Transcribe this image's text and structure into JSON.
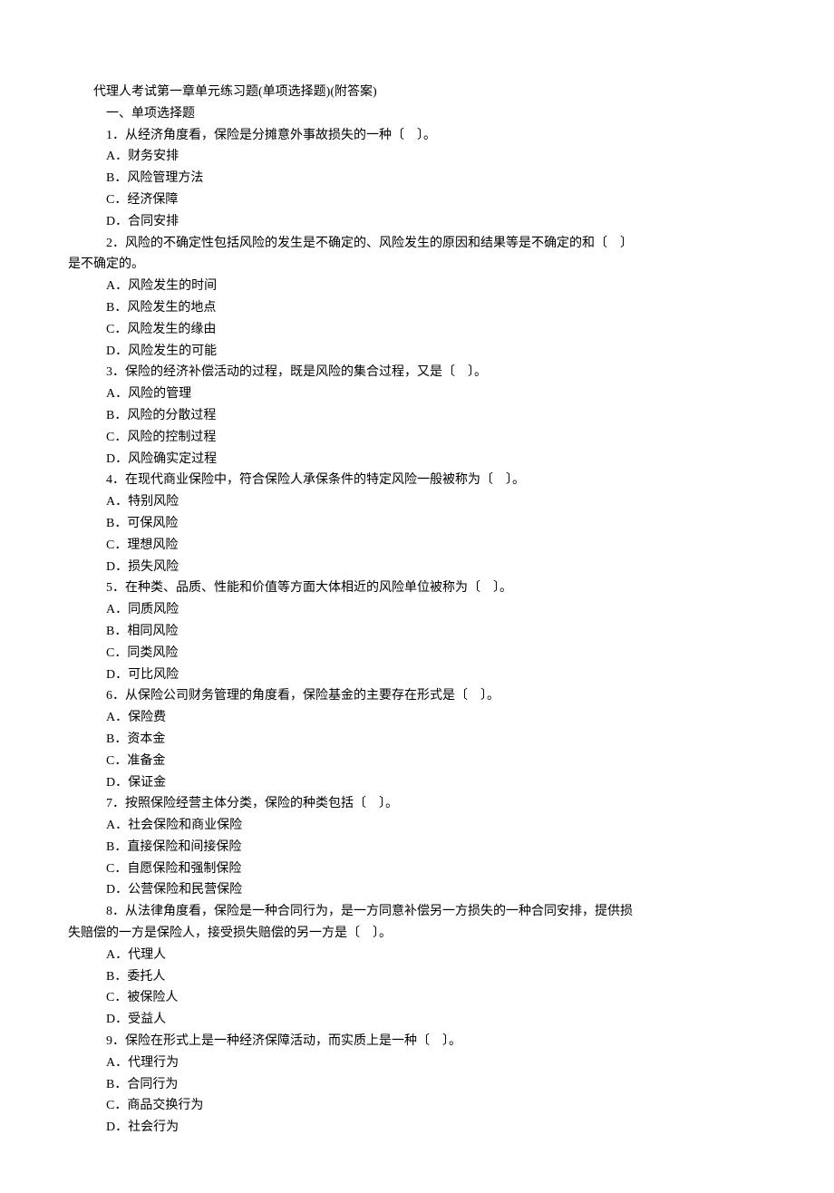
{
  "title": "代理人考试第一章单元练习题(单项选择题)(附答案)",
  "section_header": "一、单项选择题",
  "questions": [
    {
      "stem": "1．从经济角度看，保险是分摊意外事故损失的一种〔　〕。",
      "options": [
        "A．财务安排",
        "B．风险管理方法",
        "C．经济保障",
        "D．合同安排"
      ]
    },
    {
      "stem": "2．风险的不确定性包括风险的发生是不确定的、风险发生的原因和结果等是不确定的和〔　〕",
      "stem_cont": "是不确定的。",
      "options": [
        "A．风险发生的时间",
        "B．风险发生的地点",
        "C．风险发生的缘由",
        "D．风险发生的可能"
      ]
    },
    {
      "stem": "3．保险的经济补偿活动的过程，既是风险的集合过程，又是〔　〕。",
      "options": [
        "A．风险的管理",
        "B．风险的分散过程",
        "C．风险的控制过程",
        "D．风险确实定过程"
      ]
    },
    {
      "stem": "4．在现代商业保险中，符合保险人承保条件的特定风险一般被称为〔　〕。",
      "options": [
        "A．特别风险",
        "B．可保风险",
        "C．理想风险",
        "D．损失风险"
      ]
    },
    {
      "stem": "5．在种类、品质、性能和价值等方面大体相近的风险单位被称为〔　〕。",
      "options": [
        "A．同质风险",
        "B．相同风险",
        "C．同类风险",
        "D．可比风险"
      ]
    },
    {
      "stem": "6．从保险公司财务管理的角度看，保险基金的主要存在形式是〔　〕。",
      "options": [
        "A．保险费",
        "B．资本金",
        "C．准备金",
        "D．保证金"
      ]
    },
    {
      "stem": "7．按照保险经营主体分类，保险的种类包括〔　〕。",
      "options": [
        "A．社会保险和商业保险",
        "B．直接保险和间接保险",
        "C．自愿保险和强制保险",
        "D．公营保险和民营保险"
      ]
    },
    {
      "stem": "8．从法律角度看，保险是一种合同行为，是一方同意补偿另一方损失的一种合同安排，提供损",
      "stem_cont": "失赔偿的一方是保险人，接受损失赔偿的另一方是〔　〕。",
      "options": [
        "A．代理人",
        "B．委托人",
        "C．被保险人",
        "D．受益人"
      ]
    },
    {
      "stem": "9．保险在形式上是一种经济保障活动，而实质上是一种〔　〕。",
      "options": [
        "A．代理行为",
        "B．合同行为",
        "C．商品交换行为",
        "D．社会行为"
      ]
    }
  ]
}
